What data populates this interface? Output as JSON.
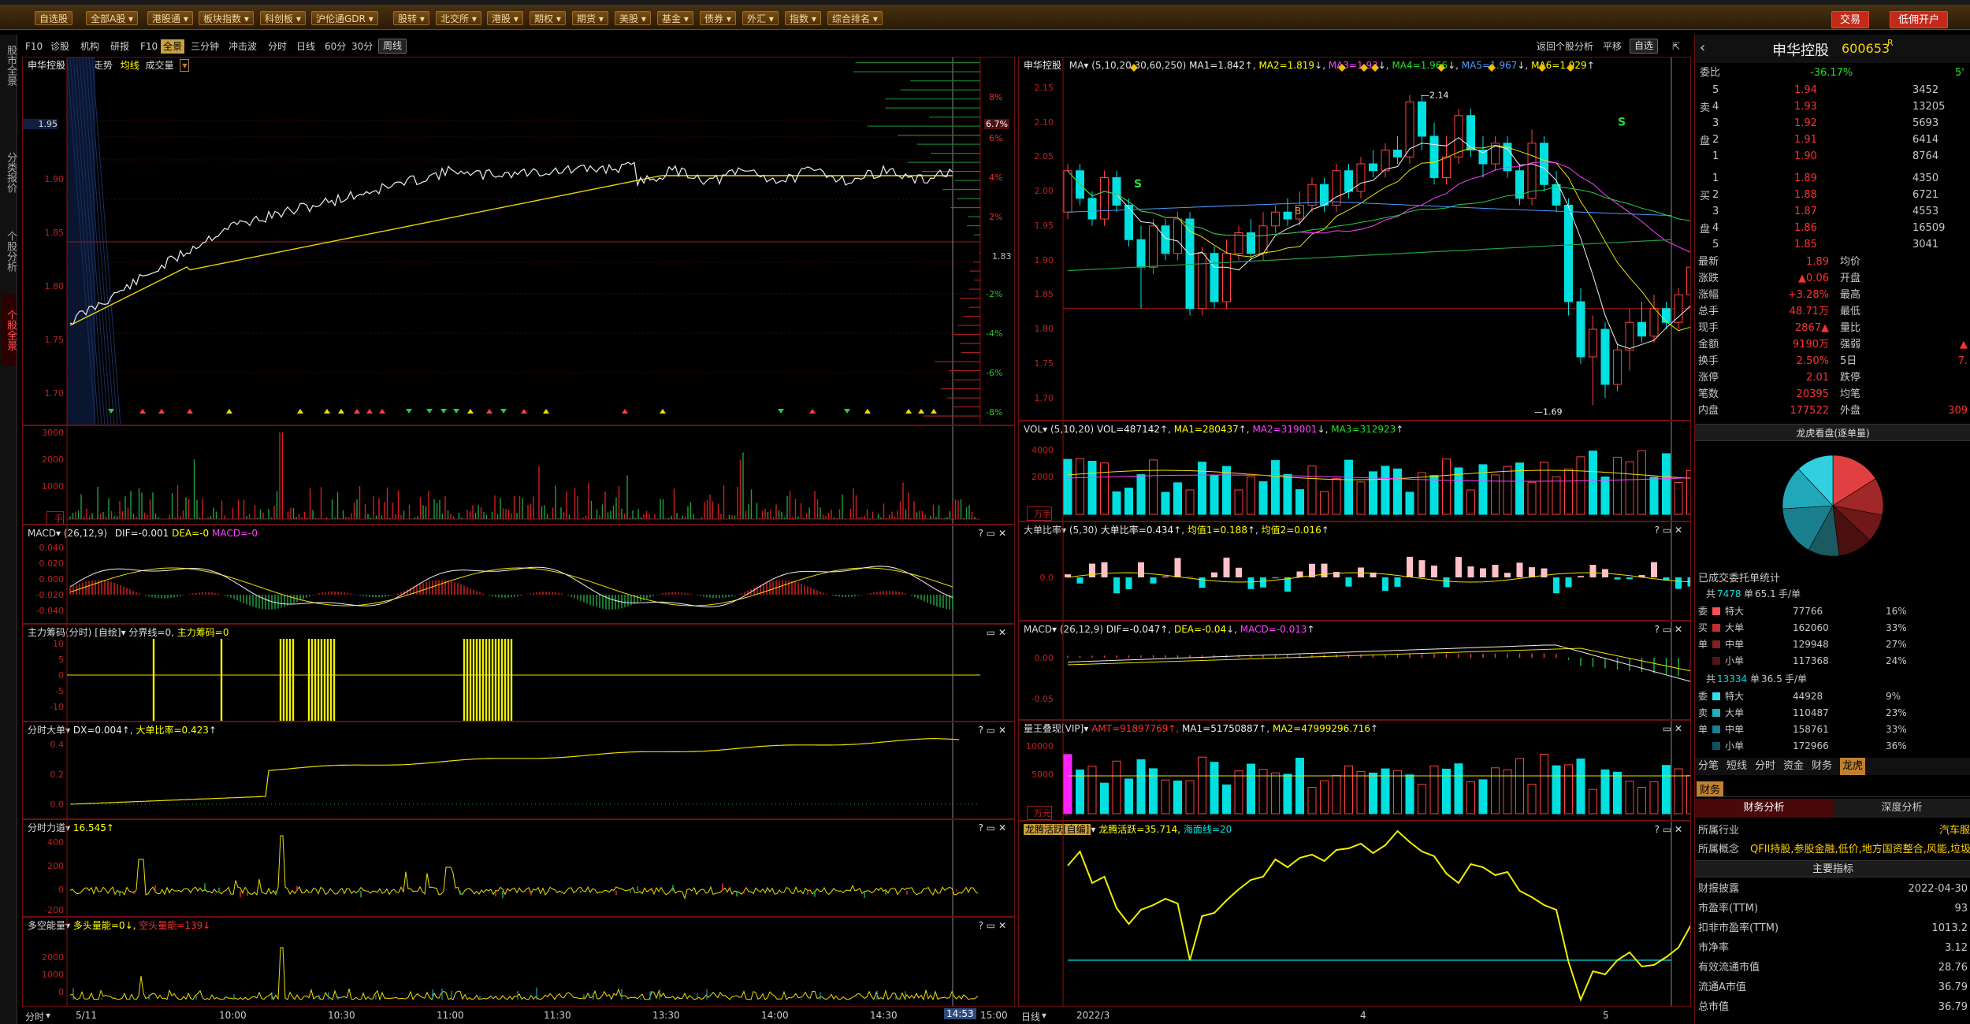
{
  "menu": {
    "items": [
      "自选股",
      "全部A股",
      "港股通",
      "板块指数",
      "科创板",
      "沪伦通GDR",
      "股转",
      "北交所",
      "港股",
      "期权",
      "期货",
      "美股",
      "基金",
      "债券",
      "外汇",
      "指数",
      "综合排名"
    ],
    "trade": "交易",
    "open_account": "低佣开户"
  },
  "rail": [
    "股市全景",
    "分类报价",
    "个股分析",
    "个股全景"
  ],
  "toolbar": {
    "items": [
      "F10",
      "诊股",
      "机构",
      "研报",
      "F10",
      "全景",
      "三分钟",
      "冲击波"
    ],
    "period_items": [
      "分时",
      "日线",
      "60分",
      "30分",
      "周线"
    ],
    "return_label": "返回个股分析",
    "flat_label": "平移",
    "watchlist_label": "自选"
  },
  "intraday": {
    "title": "申华控股",
    "subtitle": "分时走势",
    "avg_label": "均线",
    "vol_label": "成交量",
    "price_axis": [
      "1.95",
      "1.90",
      "1.85",
      "1.80",
      "1.75",
      "1.70"
    ],
    "pct_axis_red": [
      "8%",
      "6%",
      "4%",
      "2%"
    ],
    "pct_axis_green": [
      "-2%",
      "-4%",
      "-6%",
      "-8%"
    ],
    "pct_badge": "6.7%",
    "mid_price": "1.83",
    "current_price_tag": "1.95",
    "time_labels": [
      "5/11",
      "10:00",
      "10:30",
      "11:00",
      "11:30",
      "13:30",
      "14:00",
      "14:30",
      "15:00"
    ],
    "time_cursor": "14:53",
    "time_menu": "分时"
  },
  "subpanels": {
    "vol_axis": [
      "3000",
      "2000",
      "1000",
      "0"
    ],
    "vol_unit": "手",
    "macd": {
      "title": "MACD",
      "params": "(26,12,9)",
      "dif": "DIF=-0.001",
      "dea": "DEA=-0",
      "macd": "MACD=-0",
      "axis": [
        "0.040",
        "0.020",
        "0.000",
        "-0.020",
        "-0.040"
      ]
    },
    "main_chip": {
      "title": "主力筹码(分时)",
      "tag": "[自绘]",
      "boundary": "分界线=0",
      "value": "主力筹码=0",
      "axis": [
        "10",
        "5",
        "0",
        "-5",
        "-10"
      ]
    },
    "big_order": {
      "title": "分时大单",
      "dx": "DX=0.004",
      "ratio": "大单比率=0.423",
      "axis": [
        "0.4",
        "0.2",
        "0.0"
      ]
    },
    "force": {
      "title": "分时力道",
      "value": "16.545",
      "axis": [
        "400",
        "200",
        "0",
        "-200"
      ]
    },
    "longshort": {
      "title": "多空能量",
      "bull": "多头量能=0",
      "bear": "空头量能=139",
      "axis": [
        "2000",
        "1000",
        "0"
      ]
    }
  },
  "daily": {
    "title": "申华控股",
    "ma_label": "MA",
    "ma_params": "(5,10,20,30,60,250)",
    "ma1": "MA1=1.842",
    "ma2": "MA2=1.819",
    "ma3": "MA3=1.93",
    "ma4": "MA4=1.966",
    "ma5": "MA5=1.967",
    "ma6": "MA6=1.929",
    "price_axis": [
      "2.15",
      "2.10",
      "2.05",
      "2.00",
      "1.95",
      "1.90",
      "1.85",
      "1.80",
      "1.75",
      "1.70"
    ],
    "high_mark": "2.14",
    "low_mark": "1.69",
    "signal_s": "S",
    "signal_b": "B",
    "date_labels": [
      "2022/3",
      "4",
      "5"
    ],
    "period_menu": "日线",
    "vol": {
      "title": "VOL",
      "params": "(5,10,20)",
      "vol": "VOL=487142",
      "ma1": "MA1=280437",
      "ma2": "MA2=319001",
      "ma3": "MA3=312923",
      "axis": [
        "4000",
        "2000",
        "0"
      ],
      "unit": "万手"
    },
    "bigratio": {
      "title": "大单比率",
      "params": "(5,30)",
      "ratio": "大单比率=0.434",
      "avg1": "均值1=0.188",
      "avg2": "均值2=0.016",
      "axis": [
        "0.0"
      ]
    },
    "macd": {
      "title": "MACD",
      "params": "(26,12,9)",
      "dif": "DIF=-0.047",
      "dea": "DEA=-0.04",
      "macd": "MACD=-0.013",
      "axis": [
        "0.00",
        "-0.05"
      ]
    },
    "amount": {
      "title": "量王叠现[VIP]",
      "amt": "AMT=91897769",
      "ma1": "MA1=51750887",
      "ma2": "MA2=47999296.716",
      "axis": [
        "10000",
        "5000",
        "0"
      ],
      "unit": "万元"
    },
    "dragon": {
      "title": "龙腾活跃[自编]",
      "active": "龙腾活跃=35.714",
      "sea": "海面线=20"
    }
  },
  "quote": {
    "name": "申华控股",
    "code": "600653",
    "tag": "R",
    "ratio_label": "委比",
    "ratio_value": "-36.17%",
    "ratio_vol": "5'",
    "sell": [
      {
        "label": "5",
        "price": "1.94",
        "vol": "3452"
      },
      {
        "label": "4",
        "price": "1.93",
        "vol": "13205"
      },
      {
        "label": "3",
        "price": "1.92",
        "vol": "5693"
      },
      {
        "label": "2",
        "price": "1.91",
        "vol": "6414"
      },
      {
        "label": "1",
        "price": "1.90",
        "vol": "8764"
      }
    ],
    "buy": [
      {
        "label": "1",
        "price": "1.89",
        "vol": "4350"
      },
      {
        "label": "2",
        "price": "1.88",
        "vol": "6721"
      },
      {
        "label": "3",
        "price": "1.87",
        "vol": "4553"
      },
      {
        "label": "4",
        "price": "1.86",
        "vol": "16509"
      },
      {
        "label": "5",
        "price": "1.85",
        "vol": "3041"
      }
    ],
    "sell_side": "卖",
    "sell_side2": "盘",
    "buy_side": "买",
    "buy_side2": "盘",
    "stats": [
      {
        "l": "最新",
        "v": "1.89",
        "l2": "均价",
        "v2": ""
      },
      {
        "l": "涨跌",
        "v": "▲0.06",
        "l2": "开盘",
        "v2": ""
      },
      {
        "l": "涨幅",
        "v": "+3.28%",
        "l2": "最高",
        "v2": ""
      },
      {
        "l": "总手",
        "v": "48.71万",
        "l2": "最低",
        "v2": ""
      },
      {
        "l": "现手",
        "v": "2867▲",
        "l2": "量比",
        "v2": ""
      },
      {
        "l": "金额",
        "v": "9190万",
        "l2": "强弱",
        "v2": "▲"
      },
      {
        "l": "换手",
        "v": "2.50%",
        "l2": "5日",
        "v2": "7."
      },
      {
        "l": "涨停",
        "v": "2.01",
        "l2": "跌停",
        "v2": ""
      },
      {
        "l": "笔数",
        "v": "20395",
        "l2": "均笔",
        "v2": ""
      },
      {
        "l": "内盘",
        "v": "177522",
        "l2": "外盘",
        "v2": "309"
      }
    ],
    "pie_title": "龙虎看盘(逐单量)",
    "pie_slices": [
      {
        "value": 16,
        "color": "#e04040"
      },
      {
        "value": 12,
        "color": "#a02828"
      },
      {
        "value": 9,
        "color": "#701818"
      },
      {
        "value": 11,
        "color": "#4a1010"
      },
      {
        "value": 10,
        "color": "#1a5a60"
      },
      {
        "value": 16,
        "color": "#1a8090"
      },
      {
        "value": 14,
        "color": "#20a8b8"
      },
      {
        "value": 12,
        "color": "#30d0e0"
      }
    ],
    "deal_title": "已成交委托单统计",
    "buy_summary_prefix": "共",
    "buy_summary_count": "7478",
    "buy_summary_mid": "单",
    "buy_summary_avg": "65.1",
    "buy_summary_unit": "手/单",
    "buy_side_labels": [
      "委",
      "买",
      "单",
      ""
    ],
    "buy_rows": [
      {
        "name": "特大",
        "vol": "77766",
        "pct": "16%",
        "color": "#ff5050"
      },
      {
        "name": "大单",
        "vol": "162060",
        "pct": "33%",
        "color": "#c03030"
      },
      {
        "name": "中单",
        "vol": "129948",
        "pct": "27%",
        "color": "#802020"
      },
      {
        "name": "小单",
        "vol": "117368",
        "pct": "24%",
        "color": "#501515"
      }
    ],
    "sell_summary_count": "13334",
    "sell_summary_avg": "36.5",
    "sell_side_labels": [
      "委",
      "卖",
      "单",
      ""
    ],
    "sell_rows": [
      {
        "name": "特大",
        "vol": "44928",
        "pct": "9%",
        "color": "#30e0f0"
      },
      {
        "name": "大单",
        "vol": "110487",
        "pct": "23%",
        "color": "#20b0c0"
      },
      {
        "name": "中单",
        "vol": "158761",
        "pct": "33%",
        "color": "#188090"
      },
      {
        "name": "小单",
        "vol": "172966",
        "pct": "36%",
        "color": "#105060"
      }
    ],
    "tabs": [
      "分笔",
      "短线",
      "分时",
      "资金",
      "财务",
      "龙虎"
    ],
    "finance_tab": "财务",
    "fin_tab1": "财务分析",
    "fin_tab2": "深度分析",
    "industry_label": "所属行业",
    "industry_value": "汽车服",
    "concept_label": "所属概念",
    "concept_value": "QFII持股,参股金融,低价,地方国资整合,风能,垃圾",
    "key_index": "主要指标",
    "fin_rows": [
      {
        "l": "财报披露",
        "v": "2022-04-30"
      },
      {
        "l": "市盈率(TTM)",
        "v": "93"
      },
      {
        "l": "扣非市盈率(TTM)",
        "v": "1013.2"
      },
      {
        "l": "市净率",
        "v": "3.12"
      },
      {
        "l": "有效流通市值",
        "v": "28.76"
      },
      {
        "l": "流通A市值",
        "v": "36.79"
      },
      {
        "l": "总市值",
        "v": "36.79"
      }
    ]
  }
}
